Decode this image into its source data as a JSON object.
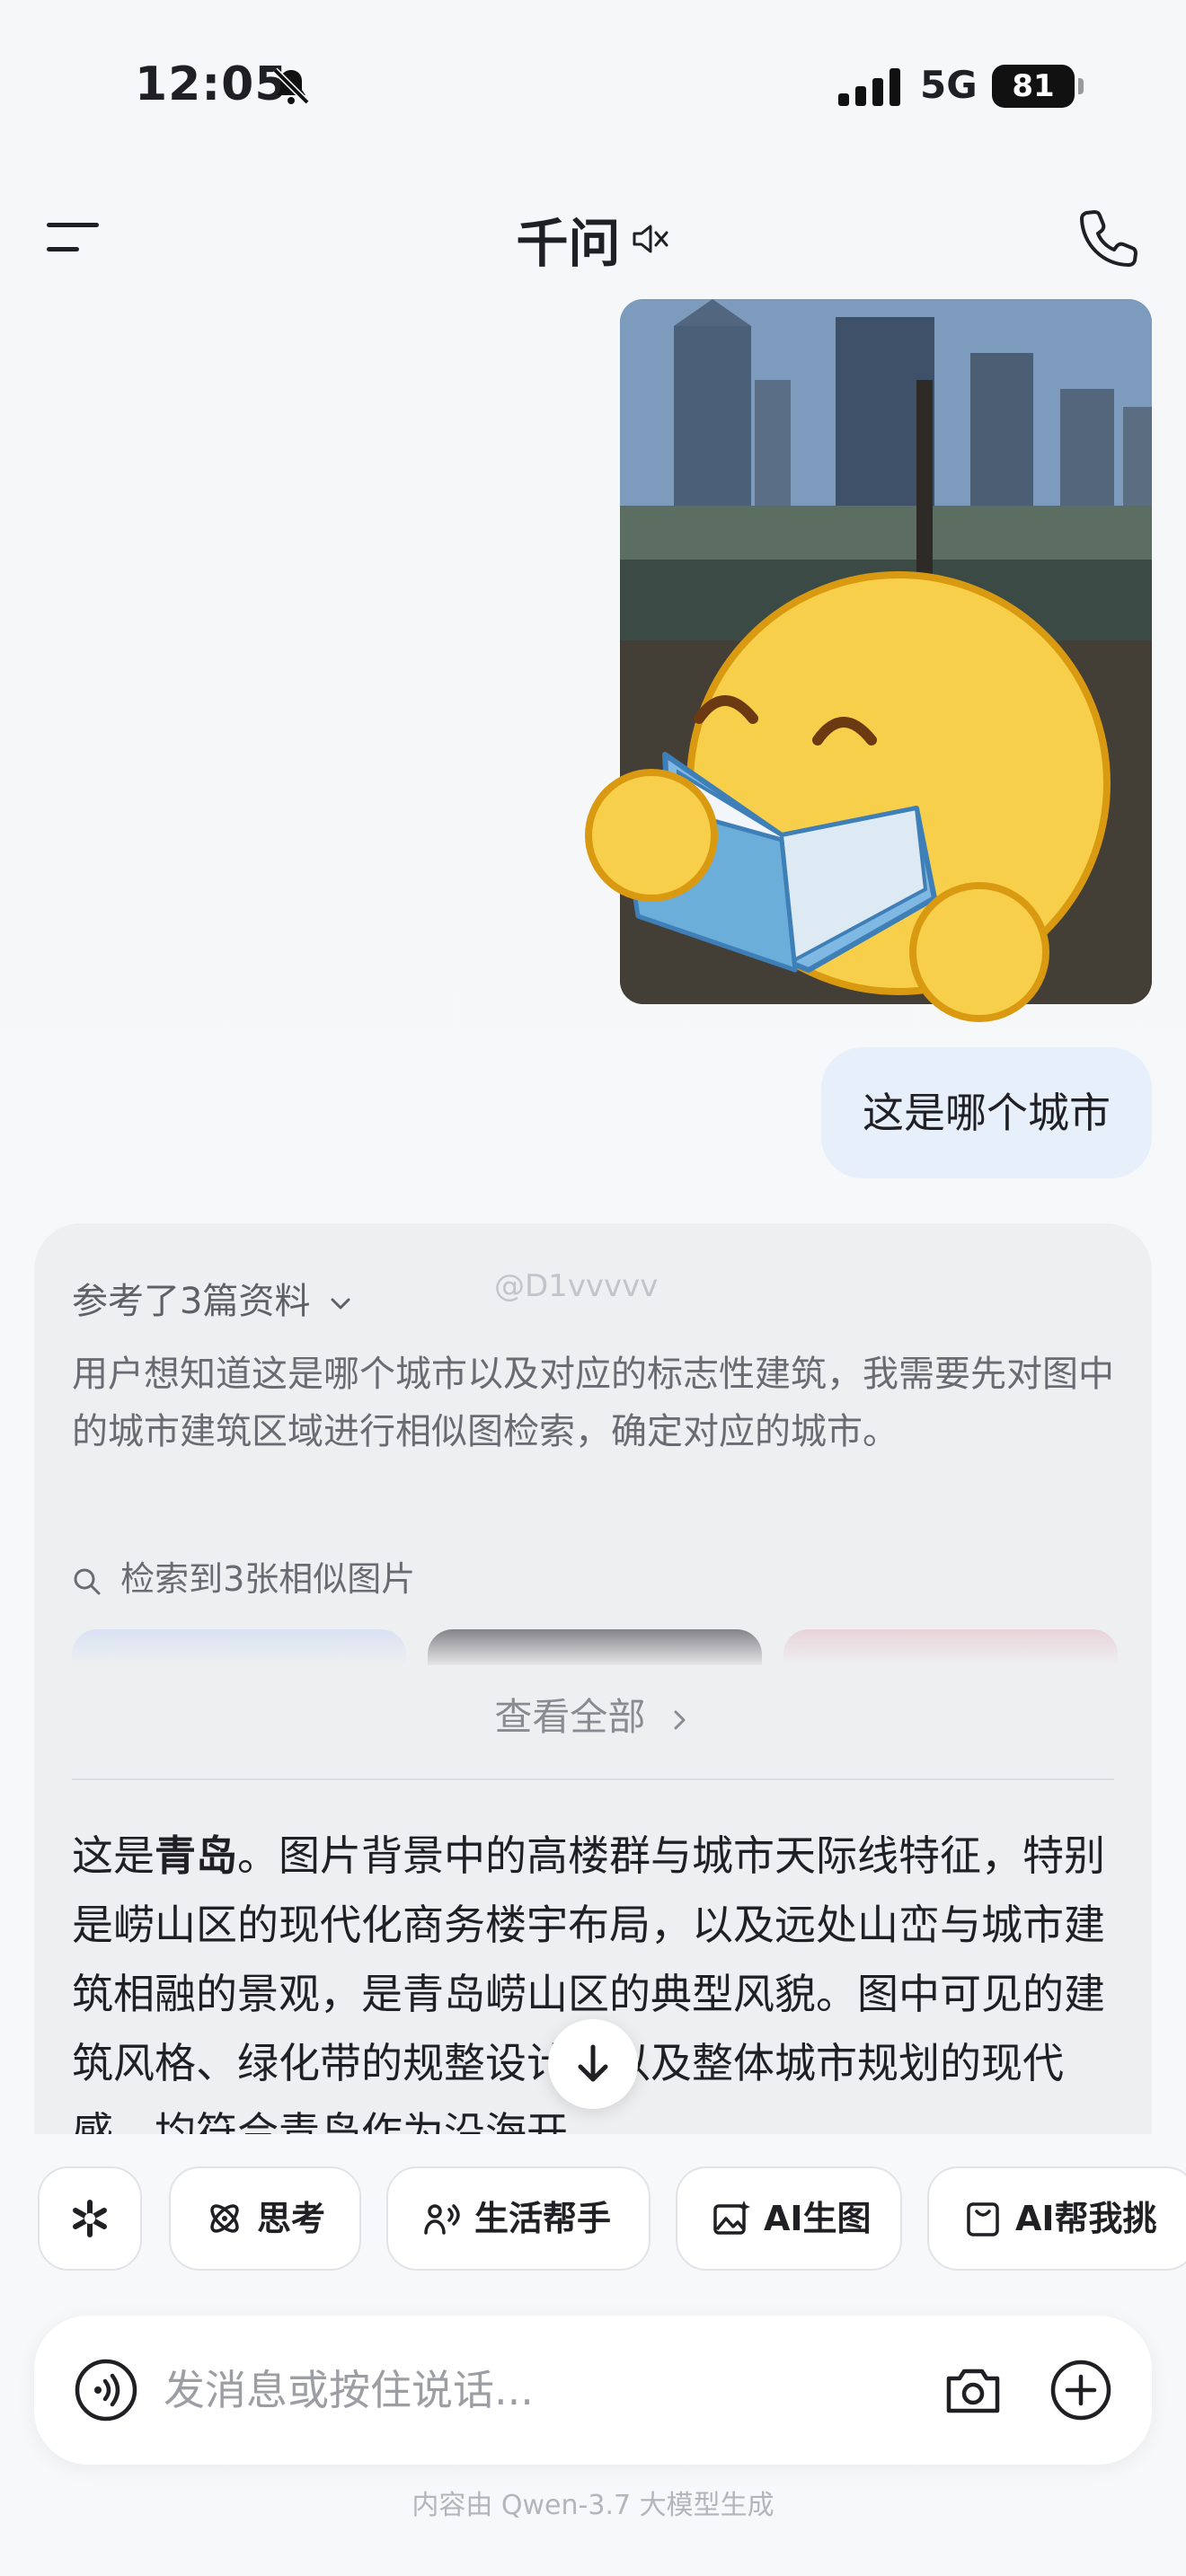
{
  "status_bar": {
    "time": "12:05",
    "network": "5G",
    "battery": "81",
    "icons": [
      "bell-slash-icon",
      "signal-icon"
    ]
  },
  "nav": {
    "title": "千问",
    "icons": [
      "menu-icon",
      "speaker-muted-icon",
      "phone-icon"
    ]
  },
  "conversation": {
    "user_message": "这是哪个城市",
    "user_attachment_icon": "reading-emoji-sticker"
  },
  "answer": {
    "references_label": "参考了3篇资料",
    "watermark": "@D1vvvvv",
    "thinking": "用户想知道这是哪个城市以及对应的标志性建筑，我需要先对图中的城市建筑区域进行相似图检索，确定对应的城市。",
    "search_result": "检索到3张相似图片",
    "view_all": "查看全部",
    "body_prefix": "这是",
    "body_bold": "青岛",
    "body_rest": "。图片背景中的高楼群与城市天际线特征，特别是崂山区的现代化商务楼宇布局，以及远处山峦与城市建筑相融的景观，是青岛崂山区的典型风貌。图中可见的建筑风格、绿化带的规整设计，以及整体城市规划的现代感，均符合青岛作为沿海开"
  },
  "chips": {
    "think": "思考",
    "life": "生活帮手",
    "ai_image": "AI生图",
    "ai_pick": "AI帮我挑"
  },
  "input": {
    "placeholder": "发消息或按住说话..."
  },
  "footer": {
    "note": "内容由 Qwen-3.7 大模型生成"
  },
  "colors": {
    "user_bubble": "#e7effb",
    "card_bg": "#eeeff1",
    "page_bg": "#f7f8fa"
  }
}
